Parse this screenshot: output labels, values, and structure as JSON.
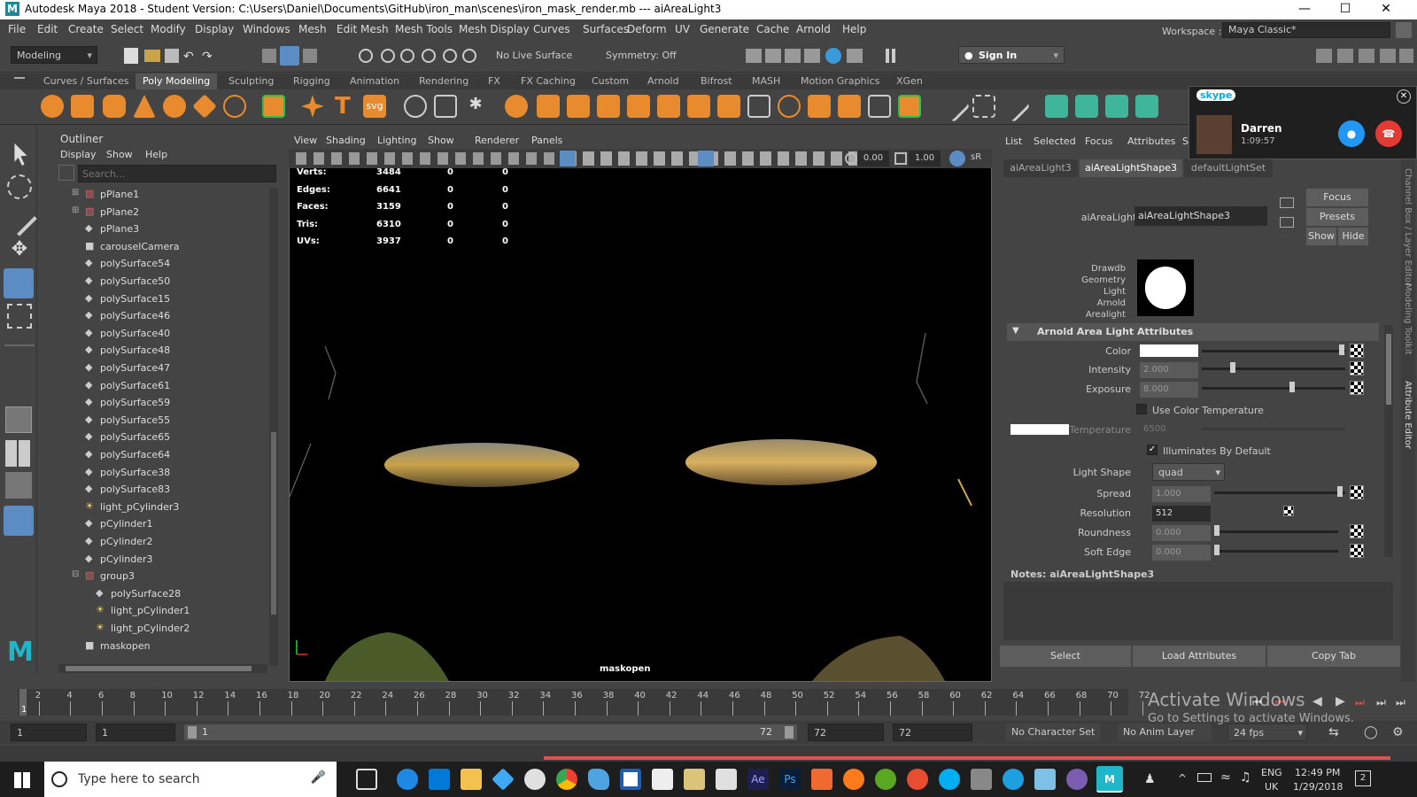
{
  "window": {
    "title": "Autodesk Maya 2018 - Student Version: C:\\Users\\Daniel\\Documents\\GitHub\\iron_man\\scenes\\iron_mask_render.mb  ---  aiAreaLight3"
  },
  "menu": [
    "File",
    "Edit",
    "Create",
    "Select",
    "Modify",
    "Display",
    "Windows",
    "Mesh",
    "Edit Mesh",
    "Mesh Tools",
    "Mesh Display",
    "Curves",
    "Surfaces",
    "Deform",
    "UV",
    "Generate",
    "Cache",
    "Arnold",
    "Help"
  ],
  "workspace": {
    "label": "Workspace :",
    "value": "Maya Classic*"
  },
  "statusline": {
    "mode": "Modeling",
    "live_surface": "No Live Surface",
    "symmetry": "Symmetry: Off",
    "sign_in": "Sign In"
  },
  "shelf_tabs": [
    "Curves / Surfaces",
    "Poly Modeling",
    "Sculpting",
    "Rigging",
    "Animation",
    "Rendering",
    "FX",
    "FX Caching",
    "Custom",
    "Arnold",
    "Bifrost",
    "MASH",
    "Motion Graphics",
    "XGen"
  ],
  "shelf_active": "Poly Modeling",
  "outliner": {
    "title": "Outliner",
    "menu": [
      "Display",
      "Show",
      "Help"
    ],
    "search_placeholder": "Search...",
    "items": [
      {
        "label": "pPlane1",
        "icon": "mesh-group-icon"
      },
      {
        "label": "pPlane2",
        "icon": "mesh-group-icon"
      },
      {
        "label": "pPlane3",
        "icon": "mesh-icon"
      },
      {
        "label": "carouselCamera",
        "icon": "camera-icon"
      },
      {
        "label": "polySurface54",
        "icon": "mesh-icon"
      },
      {
        "label": "polySurface50",
        "icon": "mesh-icon"
      },
      {
        "label": "polySurface15",
        "icon": "mesh-icon"
      },
      {
        "label": "polySurface46",
        "icon": "mesh-icon"
      },
      {
        "label": "polySurface40",
        "icon": "mesh-icon"
      },
      {
        "label": "polySurface48",
        "icon": "mesh-icon"
      },
      {
        "label": "polySurface47",
        "icon": "mesh-icon"
      },
      {
        "label": "polySurface61",
        "icon": "mesh-icon"
      },
      {
        "label": "polySurface59",
        "icon": "mesh-icon"
      },
      {
        "label": "polySurface55",
        "icon": "mesh-icon"
      },
      {
        "label": "polySurface65",
        "icon": "mesh-icon"
      },
      {
        "label": "polySurface64",
        "icon": "mesh-icon"
      },
      {
        "label": "polySurface38",
        "icon": "mesh-icon"
      },
      {
        "label": "polySurface83",
        "icon": "mesh-icon"
      },
      {
        "label": "light_pCylinder3",
        "icon": "light-icon"
      },
      {
        "label": "pCylinder1",
        "icon": "mesh-icon"
      },
      {
        "label": "pCylinder2",
        "icon": "mesh-icon"
      },
      {
        "label": "pCylinder3",
        "icon": "mesh-icon"
      },
      {
        "label": "group3",
        "icon": "group-icon"
      },
      {
        "label": "polySurface28",
        "icon": "mesh-icon"
      },
      {
        "label": "light_pCylinder1",
        "icon": "light-icon"
      },
      {
        "label": "light_pCylinder2",
        "icon": "light-icon"
      },
      {
        "label": "maskopen",
        "icon": "camera-icon"
      }
    ]
  },
  "viewport": {
    "menu": [
      "View",
      "Shading",
      "Lighting",
      "Show",
      "Renderer",
      "Panels"
    ],
    "near": "0.00",
    "far": "1.00",
    "hud": [
      {
        "label": "Verts:",
        "v1": "3484",
        "v2": "0",
        "v3": "0"
      },
      {
        "label": "Edges:",
        "v1": "6641",
        "v2": "0",
        "v3": "0"
      },
      {
        "label": "Faces:",
        "v1": "3159",
        "v2": "0",
        "v3": "0"
      },
      {
        "label": "Tris:",
        "v1": "6310",
        "v2": "0",
        "v3": "0"
      },
      {
        "label": "UVs:",
        "v1": "3937",
        "v2": "0",
        "v3": "0"
      }
    ],
    "camera": "maskopen"
  },
  "attribute_editor": {
    "menu": [
      "List",
      "Selected",
      "Focus",
      "Attributes",
      "S"
    ],
    "tabs": [
      "aiAreaLight3",
      "aiAreaLightShape3",
      "defaultLightSet"
    ],
    "active_tab": "aiAreaLightShape3",
    "node_label": "aiAreaLight:",
    "node_value": "aiAreaLightShape3",
    "buttons": {
      "focus": "Focus",
      "presets": "Presets",
      "show": "Show",
      "hide": "Hide"
    },
    "swatch_text": [
      "Drawdb",
      "Geometry",
      "Light",
      "Arnold",
      "Arealight"
    ],
    "section": "Arnold Area Light Attributes",
    "color_label": "Color",
    "intensity_label": "Intensity",
    "intensity_value": "2.000",
    "intensity_level": 0.2,
    "exposure_label": "Exposure",
    "exposure_value": "8.000",
    "exposure_level": 0.61,
    "use_color_temp": "Use Color Temperature",
    "temperature_label": "Temperature",
    "temperature_value": "6500",
    "illuminates": "Illuminates By Default",
    "light_shape_label": "Light Shape",
    "light_shape_value": "quad",
    "spread_label": "Spread",
    "spread_value": "1.000",
    "resolution_label": "Resolution",
    "resolution_value": "512",
    "roundness_label": "Roundness",
    "roundness_value": "0.000",
    "soft_edge_label": "Soft Edge",
    "soft_edge_value": "0.000",
    "notes_label": "Notes:  aiAreaLightShape3",
    "bottom": {
      "select": "Select",
      "load": "Load Attributes",
      "copy": "Copy Tab"
    },
    "side_tabs": [
      "Channel Box / Layer Editor",
      "Modeling Toolkit",
      "Attribute Editor"
    ]
  },
  "skype": {
    "brand": "skype",
    "name": "Darren",
    "duration": "1:09:57"
  },
  "timeline": {
    "ticks": [
      "2",
      "4",
      "6",
      "8",
      "10",
      "12",
      "14",
      "16",
      "18",
      "20",
      "22",
      "24",
      "26",
      "28",
      "30",
      "32",
      "34",
      "36",
      "38",
      "40",
      "42",
      "44",
      "46",
      "48",
      "50",
      "52",
      "54",
      "56",
      "58",
      "60",
      "62",
      "64",
      "66",
      "68",
      "70",
      "72"
    ],
    "current": "1"
  },
  "range": {
    "start": "1",
    "start2": "1",
    "slider_start": "1",
    "slider_end": "72",
    "end": "72",
    "end2": "72",
    "character_set": "No Character Set",
    "anim_layer": "No Anim Layer",
    "fps": "24 fps"
  },
  "watermark": {
    "line1": "Activate Windows",
    "line2": "Go to Settings to activate Windows."
  },
  "taskbar": {
    "search": "Type here to search",
    "lang1": "ENG",
    "lang2": "UK",
    "time": "12:49 PM",
    "date": "1/29/2018",
    "notif": "2"
  }
}
